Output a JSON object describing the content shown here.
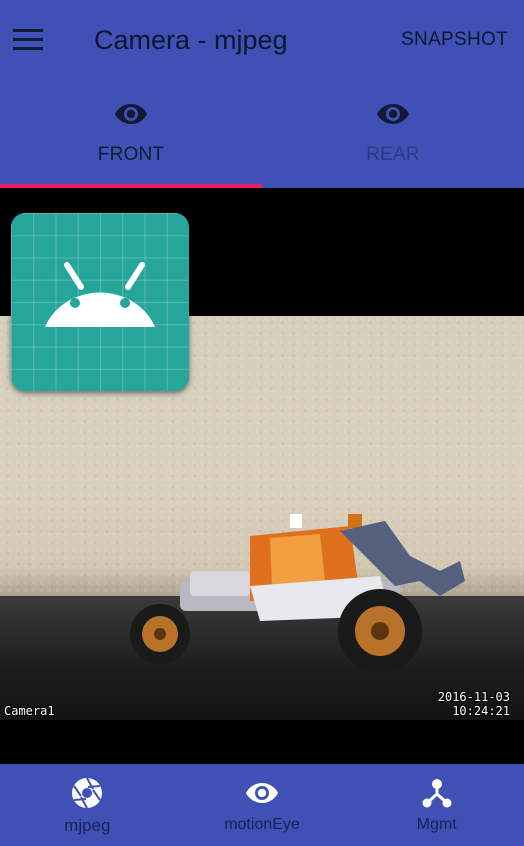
{
  "app_bar": {
    "title": "Camera - mjpeg",
    "action": "SNAPSHOT",
    "menu_icon": "hamburger-menu-icon"
  },
  "tabs": [
    {
      "label": "FRONT",
      "icon": "eye-icon",
      "active": true
    },
    {
      "label": "REAR",
      "icon": "eye-icon",
      "active": false
    }
  ],
  "video": {
    "camera_label": "Camera1",
    "date": "2016-11-03",
    "time": "10:24:21"
  },
  "bottom_nav": [
    {
      "label": "mjpeg",
      "icon": "aperture-icon",
      "active": true
    },
    {
      "label": "motionEye",
      "icon": "eye-icon",
      "active": false
    },
    {
      "label": "Mgmt",
      "icon": "network-icon",
      "active": false
    }
  ],
  "colors": {
    "primary": "#3F51B5",
    "accent": "#E91E63",
    "app_icon_bg": "#26A69A",
    "icon_dark": "#141a33"
  }
}
